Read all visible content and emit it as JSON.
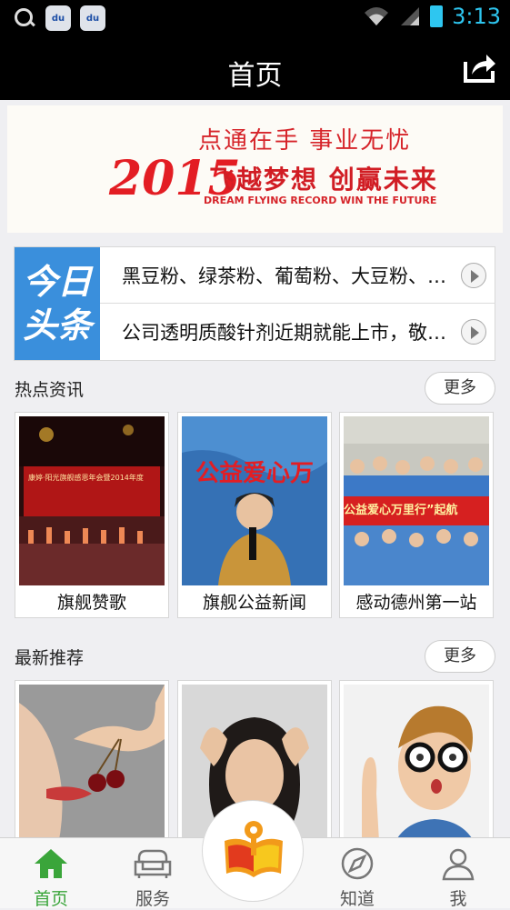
{
  "status_bar": {
    "time": "3:13",
    "badge_text": "du"
  },
  "header": {
    "title": "首页"
  },
  "banner": {
    "slogan": "点通在手  事业无忧",
    "year": "2015",
    "headline": "飞越梦想 创赢未来",
    "subline": "DREAM FLYING RECORD WIN THE FUTURE"
  },
  "headlines": {
    "badge_line1": "今日",
    "badge_line2": "头条",
    "items": [
      {
        "text": "黑豆粉、绿茶粉、葡萄粉、大豆粉、燕麦粉"
      },
      {
        "text": "公司透明质酸针剂近期就能上市，敬请期待"
      }
    ]
  },
  "hot_news": {
    "title": "热点资讯",
    "more_label": "更多",
    "items": [
      {
        "caption": "旗舰赞歌",
        "img_text": "康婷·阳光旗舰感恩年会暨2014年度"
      },
      {
        "caption": "旗舰公益新闻",
        "img_text": "公益爱心万"
      },
      {
        "caption": "感动德州第一站",
        "img_text": "公益爱心万里行”起航"
      }
    ]
  },
  "recommend": {
    "title": "最新推荐",
    "more_label": "更多"
  },
  "tabs": [
    {
      "label": "首页",
      "icon": "home-icon",
      "active": true
    },
    {
      "label": "服务",
      "icon": "sofa-icon",
      "active": false
    },
    {
      "label": "知道",
      "icon": "compass-icon",
      "active": false
    },
    {
      "label": "我",
      "icon": "person-icon",
      "active": false
    }
  ],
  "colors": {
    "accent": "#3aa53a",
    "headline_badge": "#3a8fdc",
    "banner_red": "#d6242a",
    "clock": "#2ec6f0"
  }
}
